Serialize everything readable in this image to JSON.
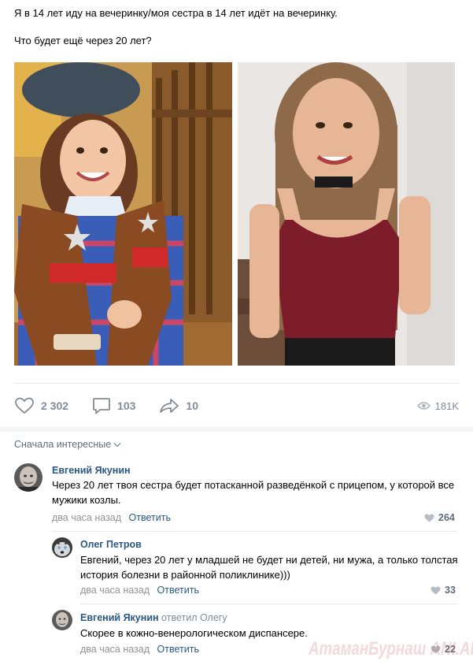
{
  "post": {
    "line1": "Я в 14 лет иду на вечеринку/моя сестра в 14 лет идёт на вечеринку.",
    "line2": "Что будет ещё через 20 лет?"
  },
  "actions": {
    "likes": "2 302",
    "comments": "103",
    "shares": "10",
    "views": "181K"
  },
  "comments_sort": "Сначала интересные",
  "comments": [
    {
      "author": "Евгений Якунин",
      "text": "Через 20 лет твоя сестра будет потасканной разведёнкой с прицепом, у которой все мужики козлы.",
      "time": "два часа назад",
      "reply_label": "Ответить",
      "likes": "264",
      "avatar_icon": "avatar-bald-man-icon"
    },
    {
      "author": "Олег Петров",
      "text": "Евгений, через 20 лет у младшей не будет ни детей, ни мужа, а только толстая история болезни в районной поликлинике)))",
      "time": "два часа назад",
      "reply_label": "Ответить",
      "likes": "33",
      "avatar_icon": "avatar-husky-icon"
    },
    {
      "author": "Евгений Якунин",
      "replied_to": "ответил Олегу",
      "text": "Скорее в кожно-венерологическом диспансере.",
      "time": "два часа назад",
      "reply_label": "Ответить",
      "likes": "22",
      "avatar_icon": "avatar-bald-man-icon"
    }
  ],
  "watermark": "АтаманБурнаш ANI.AП",
  "colors": {
    "link": "#2a5885",
    "meta": "#939393",
    "icon": "#828a99",
    "divider": "#e7e8ec"
  }
}
